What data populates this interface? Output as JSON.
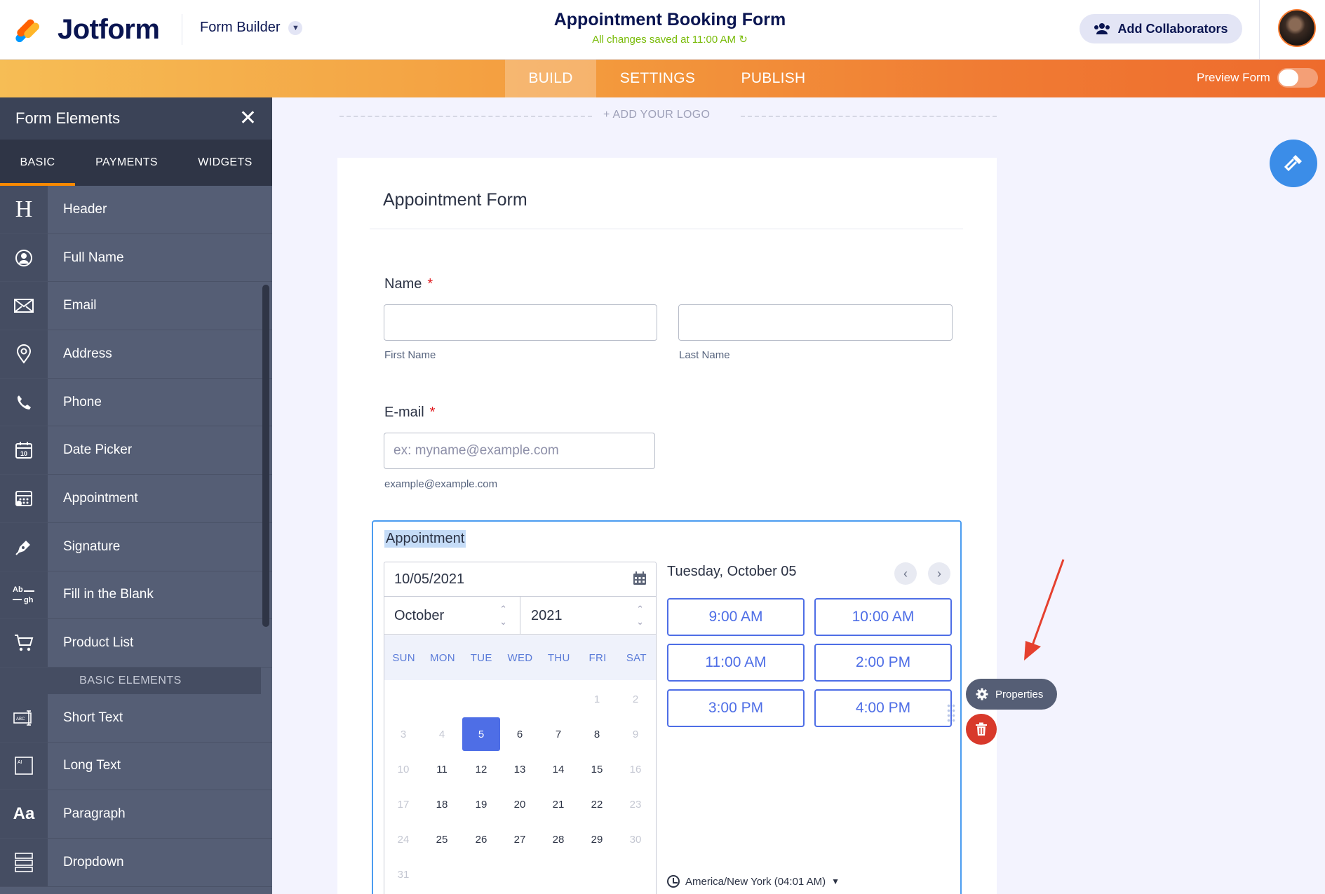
{
  "app": {
    "brand": "Jotform",
    "mode_label": "Form Builder",
    "form_title": "Appointment Booking Form",
    "saved_status": "All changes saved at 11:00 AM",
    "collaborators_label": "Add Collaborators"
  },
  "nav": {
    "tabs": [
      {
        "label": "BUILD",
        "active": true
      },
      {
        "label": "SETTINGS",
        "active": false
      },
      {
        "label": "PUBLISH",
        "active": false
      }
    ],
    "preview_label": "Preview Form"
  },
  "sidebar": {
    "title": "Form Elements",
    "tabs": [
      {
        "label": "BASIC",
        "active": true
      },
      {
        "label": "PAYMENTS",
        "active": false
      },
      {
        "label": "WIDGETS",
        "active": false
      }
    ],
    "items": [
      {
        "label": "Header",
        "icon": "header-icon"
      },
      {
        "label": "Full Name",
        "icon": "user-icon"
      },
      {
        "label": "Email",
        "icon": "envelope-icon"
      },
      {
        "label": "Address",
        "icon": "location-pin-icon"
      },
      {
        "label": "Phone",
        "icon": "phone-icon"
      },
      {
        "label": "Date Picker",
        "icon": "calendar-icon"
      },
      {
        "label": "Appointment",
        "icon": "appointment-calendar-icon"
      },
      {
        "label": "Signature",
        "icon": "pen-icon"
      },
      {
        "label": "Fill in the Blank",
        "icon": "fill-blank-icon"
      },
      {
        "label": "Product List",
        "icon": "cart-icon"
      }
    ],
    "section_label": "BASIC ELEMENTS",
    "basic_items": [
      {
        "label": "Short Text",
        "icon": "short-text-icon"
      },
      {
        "label": "Long Text",
        "icon": "long-text-icon"
      },
      {
        "label": "Paragraph",
        "icon": "paragraph-icon"
      },
      {
        "label": "Dropdown",
        "icon": "dropdown-icon"
      }
    ]
  },
  "canvas": {
    "add_logo_label": "+ ADD YOUR LOGO"
  },
  "form": {
    "heading": "Appointment Form",
    "name_field": {
      "label": "Name",
      "required_mark": "*",
      "first_sublabel": "First Name",
      "last_sublabel": "Last Name"
    },
    "email_field": {
      "label": "E-mail",
      "required_mark": "*",
      "placeholder": "ex: myname@example.com",
      "sublabel": "example@example.com"
    },
    "appointment": {
      "label": "Appointment",
      "date_value": "10/05/2021",
      "month": "October",
      "year": "2021",
      "weekdays": [
        "SUN",
        "MON",
        "TUE",
        "WED",
        "THU",
        "FRI",
        "SAT"
      ],
      "days": [
        "1",
        "2",
        "3",
        "4",
        "5",
        "6",
        "7",
        "8",
        "9",
        "10",
        "11",
        "12",
        "13",
        "14",
        "15",
        "16",
        "17",
        "18",
        "19",
        "20",
        "21",
        "22",
        "23",
        "24",
        "25",
        "26",
        "27",
        "28",
        "29",
        "30",
        "31"
      ],
      "selected_day": "5",
      "selected_date_text": "Tuesday, October 05",
      "slots": [
        "9:00 AM",
        "10:00 AM",
        "11:00 AM",
        "2:00 PM",
        "3:00 PM",
        "4:00 PM"
      ],
      "timezone": "America/New York (04:01 AM)"
    }
  },
  "actions": {
    "properties_label": "Properties"
  },
  "colors": {
    "brand_navy": "#0a1551",
    "accent_orange": "#f39a3d",
    "selected_blue": "#4e6ee6",
    "annotation_red": "#e5402f"
  }
}
